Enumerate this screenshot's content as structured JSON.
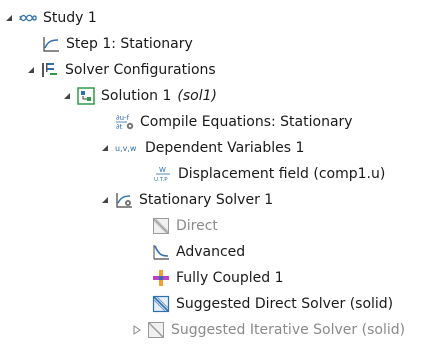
{
  "tree": {
    "study": {
      "label": "Study 1"
    },
    "step1": {
      "label": "Step 1: Stationary"
    },
    "solver_configs": {
      "label": "Solver Configurations"
    },
    "solution": {
      "label": "Solution 1",
      "tag": "(sol1)"
    },
    "compile_equations": {
      "label": "Compile Equations: Stationary",
      "icon_text": {
        "top": "∂u-f",
        "bottom": "∂t"
      }
    },
    "dependent_vars": {
      "label": "Dependent Variables 1",
      "icon_text": "u,v,w"
    },
    "displacement": {
      "label": "Displacement field (comp1.u)",
      "icon_text": {
        "top": "W",
        "bottom": "U.T.P"
      }
    },
    "stationary_solver": {
      "label": "Stationary Solver 1"
    },
    "direct": {
      "label": "Direct"
    },
    "advanced": {
      "label": "Advanced"
    },
    "fully_coupled": {
      "label": "Fully Coupled 1"
    },
    "suggested_direct": {
      "label": "Suggested Direct Solver (solid)"
    },
    "suggested_iterative": {
      "label": "Suggested Iterative Solver (solid)"
    }
  },
  "colors": {
    "text": "#1a1a1a",
    "disabled_text": "#8a8a8a",
    "study_icon": "#2f6fb0",
    "solution_icon": "#2e9a48",
    "fully_coupled_magenta": "#c23fc8",
    "fully_coupled_orange": "#f0a030",
    "solver_blue": "#2f6fb0"
  }
}
